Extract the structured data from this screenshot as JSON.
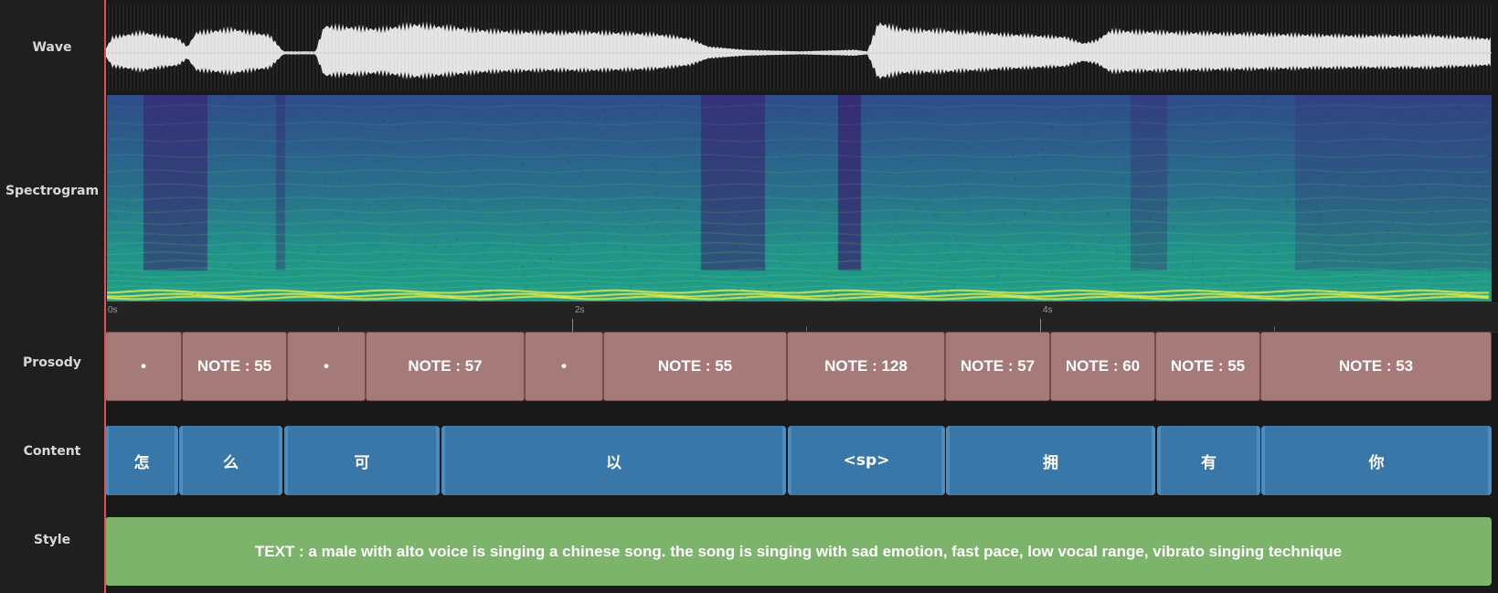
{
  "rows": {
    "wave": "Wave",
    "spectrogram": "Spectrogram",
    "prosody": "Prosody",
    "content": "Content",
    "style": "Style"
  },
  "ruler": {
    "ticks": [
      "0s",
      "2s",
      "4s"
    ]
  },
  "prosody": [
    {
      "label": "•"
    },
    {
      "label": "NOTE : 55"
    },
    {
      "label": "•"
    },
    {
      "label": "NOTE : 57"
    },
    {
      "label": "•"
    },
    {
      "label": "NOTE : 55"
    },
    {
      "label": "NOTE : 128"
    },
    {
      "label": "NOTE : 57"
    },
    {
      "label": "NOTE : 60"
    },
    {
      "label": "NOTE : 55"
    },
    {
      "label": "NOTE : 53"
    }
  ],
  "content": [
    {
      "label": "怎"
    },
    {
      "label": "么"
    },
    {
      "label": "可"
    },
    {
      "label": "以"
    },
    {
      "label": "<sp>"
    },
    {
      "label": "拥"
    },
    {
      "label": "有"
    },
    {
      "label": "你"
    }
  ],
  "style": {
    "text": "TEXT : a male with alto voice is singing a chinese song. the song is singing with sad emotion, fast pace, low vocal range, vibrato singing technique"
  },
  "colors": {
    "prosody": "#a77a7a",
    "content": "#3a77a9",
    "style": "#7db46b",
    "playhead": "#e05050"
  }
}
